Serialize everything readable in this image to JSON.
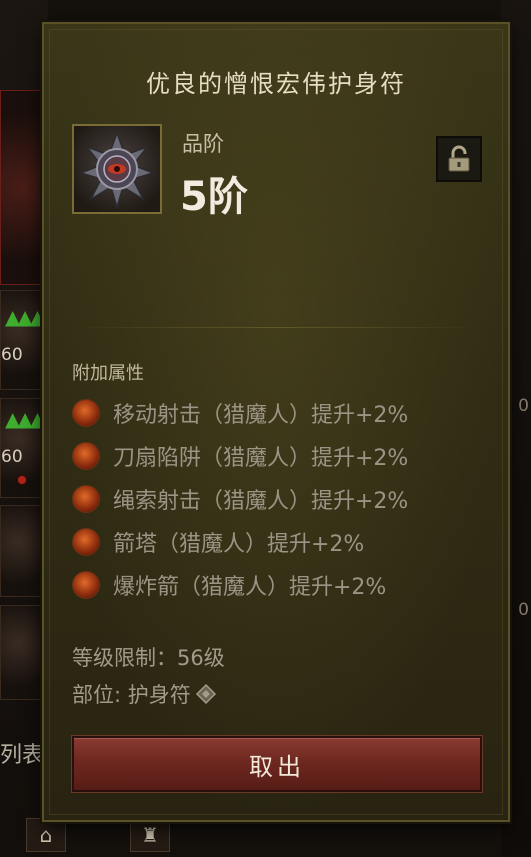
{
  "background": {
    "upgrade_count_1": "60",
    "upgrade_count_2": "60",
    "side_label": "列表",
    "right_mark_1": "0",
    "right_mark_2": "0"
  },
  "tooltip": {
    "item_name": "优良的憎恨宏伟护身符",
    "item_icon": "amulet-gem-icon",
    "grade_label": "品阶",
    "grade_value": "5阶",
    "lock_icon": "unlocked-padlock-icon",
    "attributes_title": "附加属性",
    "attributes": [
      {
        "text": "移动射击（猎魔人）提升+2%",
        "icon": "arrow-skill-icon"
      },
      {
        "text": "刀扇陷阱（猎魔人）提升+2%",
        "icon": "blade-fan-skill-icon"
      },
      {
        "text": "绳索射击（猎魔人）提升+2%",
        "icon": "rope-shot-skill-icon"
      },
      {
        "text": "箭塔（猎魔人）提升+2%",
        "icon": "arrow-tower-skill-icon"
      },
      {
        "text": "爆炸箭（猎魔人）提升+2%",
        "icon": "explosive-arrow-skill-icon"
      }
    ],
    "level_requirement": "等级限制：56级",
    "slot": "部位: 护身符",
    "slot_icon": "amulet-slot-icon",
    "take_out_button": "取出"
  },
  "colors": {
    "panel_bg": "#302c14",
    "panel_border": "#5a5226",
    "button_red": "#6e2820",
    "title_text": "#e6ddc4",
    "attribute_text": "#9b9485",
    "upgrade_arrow_green": "#3fae2f"
  }
}
